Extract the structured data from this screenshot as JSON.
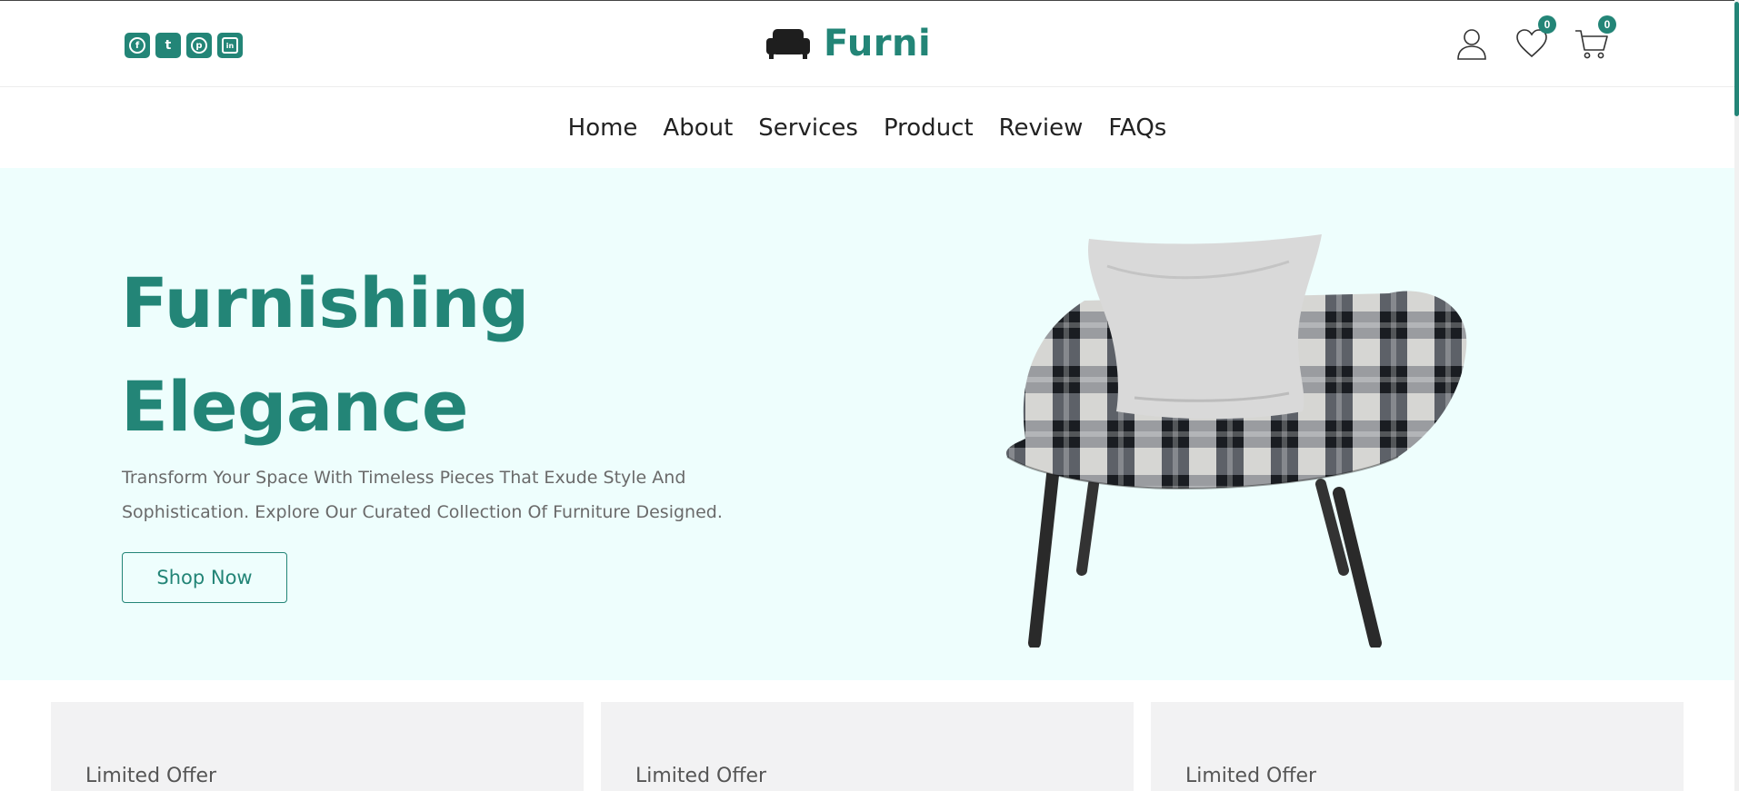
{
  "brand": {
    "name": "Furni",
    "accent": "#238577"
  },
  "social": [
    {
      "icon": "facebook-icon",
      "glyph": "f"
    },
    {
      "icon": "twitter-icon",
      "glyph": "t"
    },
    {
      "icon": "pinterest-icon",
      "glyph": "p"
    },
    {
      "icon": "linkedin-icon",
      "glyph": "in"
    }
  ],
  "header_icons": {
    "wishlist_count": "0",
    "cart_count": "0"
  },
  "nav": {
    "items": [
      "Home",
      "About",
      "Services",
      "Product",
      "Review",
      "FAQs"
    ]
  },
  "hero": {
    "title_line1": "Furnishing",
    "title_line2": "Elegance",
    "desc_line1": "Transform Your Space With Timeless Pieces That Exude Style And",
    "desc_line2": "Sophistication. Explore Our Curated Collection Of Furniture Designed.",
    "button": "Shop Now",
    "background": "#eefefd"
  },
  "offers": [
    {
      "label": "Limited Offer"
    },
    {
      "label": "Limited Offer"
    },
    {
      "label": "Limited Offer"
    }
  ]
}
